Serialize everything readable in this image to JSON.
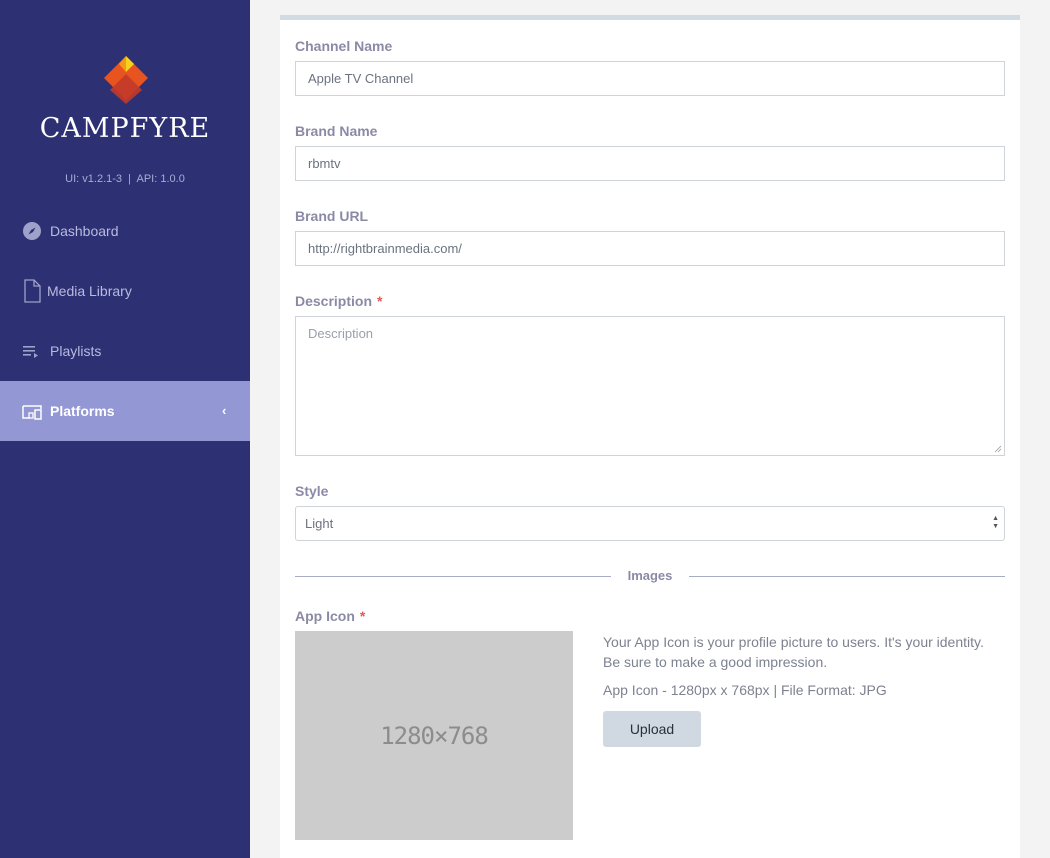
{
  "sidebar": {
    "brand": "CAMPFYRE",
    "version": "UI: v1.2.1-3  |  API: 1.0.0",
    "items": [
      {
        "label": "Dashboard",
        "icon": "compass-icon"
      },
      {
        "label": "Media Library",
        "icon": "document-icon"
      },
      {
        "label": "Playlists",
        "icon": "playlist-icon"
      },
      {
        "label": "Platforms",
        "icon": "devices-icon",
        "active": true
      }
    ]
  },
  "form": {
    "channel_name": {
      "label": "Channel Name",
      "value": "Apple TV Channel"
    },
    "brand_name": {
      "label": "Brand Name",
      "value": "rbmtv"
    },
    "brand_url": {
      "label": "Brand URL",
      "value": "http://rightbrainmedia.com/"
    },
    "description": {
      "label": "Description",
      "required_mark": "*",
      "placeholder": "Description"
    },
    "style": {
      "label": "Style",
      "value": "Light"
    }
  },
  "images": {
    "section_title": "Images",
    "app_icon": {
      "label": "App Icon",
      "required_mark": "*",
      "placeholder_text": "1280×768",
      "help": "Your App Icon is your profile picture to users. It's your identity. Be sure to make a good impression.",
      "spec": "App Icon - 1280px x 768px | File Format: JPG",
      "upload_label": "Upload"
    }
  },
  "colors": {
    "sidebar_bg": "#2d3072",
    "active_item_bg": "#9397d4",
    "required": "#e05a5a",
    "logo_orange": "#e8541f",
    "logo_yellow": "#f6d31b"
  }
}
